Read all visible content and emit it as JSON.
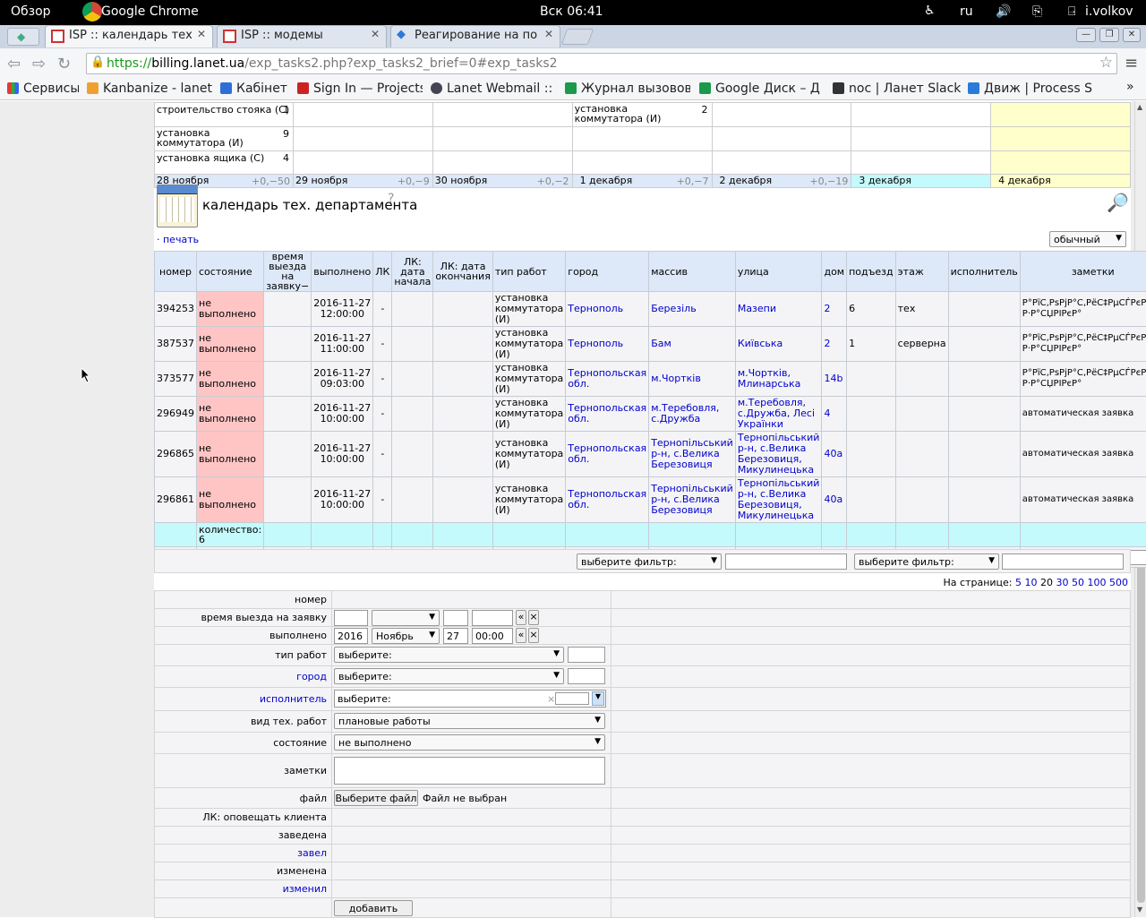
{
  "system": {
    "overview": "Обзор",
    "app": "Google Chrome",
    "clock": "Вск 06:41",
    "lang": "ru",
    "user": "i.volkov"
  },
  "tabs": [
    {
      "label": "ISP :: календарь тех"
    },
    {
      "label": "ISP :: модемы"
    },
    {
      "label": "Реагирование на по"
    }
  ],
  "url": {
    "scheme": "https://",
    "host": "billing.lanet.ua",
    "path": "/exp_tasks2.php?exp_tasks2_brief=0#exp_tasks2"
  },
  "bookmarks": [
    "Сервисы",
    "Kanbanize - lanet",
    "Кабінет",
    "Sign In — Projects",
    "Lanet Webmail :: ,",
    "Журнал вызовов",
    "Google Диск – Д",
    "noc | Ланет Slack",
    "Движ | Process S"
  ],
  "calendar": {
    "rows": [
      {
        "a": "строительство стояка (С)",
        "an": "1",
        "d": "установка коммутатора (И)",
        "dn": "2"
      },
      {
        "a": "установка коммутатора (И)",
        "an": "9",
        "d": "",
        "dn": ""
      },
      {
        "a": "установка ящика (С)",
        "an": "4",
        "d": "",
        "dn": ""
      }
    ],
    "days": [
      {
        "label": "28 ноября",
        "delta": "+0,−50"
      },
      {
        "label": "29 ноября",
        "delta": "+0,−9"
      },
      {
        "label": "30 ноября",
        "delta": "+0,−2"
      },
      {
        "label": "1 декабря",
        "delta": "+0,−7"
      },
      {
        "label": "2 декабря",
        "delta": "+0,−19"
      },
      {
        "label": "3 декабря",
        "delta": ""
      },
      {
        "label": "4 декабря",
        "delta": ""
      }
    ]
  },
  "section": {
    "title": "календарь тех. департамента",
    "help": "?",
    "print": "· печать",
    "view": "обычный"
  },
  "table": {
    "headers": [
      "номер",
      "состояние",
      "время выезда на заявку−",
      "выполнено",
      "ЛК",
      "ЛК: дата начала",
      "ЛК: дата окончания",
      "тип работ",
      "город",
      "массив",
      "улица",
      "дом",
      "подъезд",
      "этаж",
      "исполнитель",
      "заметки"
    ],
    "rows": [
      {
        "num": "394253",
        "state": "не выполнено",
        "done": "2016-11-27 12:00:00",
        "lk": "-",
        "type": "установка коммутатора (И)",
        "city": "Тернополь",
        "mass": "Березіль",
        "street": "Мазепи",
        "house": "2",
        "entr": "6",
        "floor": "тех",
        "note": "Р°РїС‚РѕРјР°С‚РёС‡РµСЃРєР°СЏ Р·Р°СЏРІРєР°"
      },
      {
        "num": "387537",
        "state": "не выполнено",
        "done": "2016-11-27 11:00:00",
        "lk": "-",
        "type": "установка коммутатора (И)",
        "city": "Тернополь",
        "mass": "Бам",
        "street": "Київська",
        "house": "2",
        "entr": "1",
        "floor": "серверна",
        "note": "Р°РїС‚РѕРјР°С‚РёС‡РµСЃРєР°СЏ Р·Р°СЏРІРєР°"
      },
      {
        "num": "373577",
        "state": "не выполнено",
        "done": "2016-11-27 09:03:00",
        "lk": "-",
        "type": "установка коммутатора (И)",
        "city": "Тернопольская обл.",
        "mass": "м.Чортків",
        "street": "м.Чортків, Млинарська",
        "house": "14b",
        "entr": "",
        "floor": "",
        "note": "Р°РїС‚РѕРјР°С‚РёС‡РµСЃРєР°СЏ Р·Р°СЏРІРєР°"
      },
      {
        "num": "296949",
        "state": "не выполнено",
        "done": "2016-11-27 10:00:00",
        "lk": "-",
        "type": "установка коммутатора (И)",
        "city": "Тернопольская обл.",
        "mass": "м.Теребовля, с.Дружба",
        "street": "м.Теребовля, с.Дружба, Лесі Українки",
        "house": "4",
        "entr": "",
        "floor": "",
        "note": "автоматическая заявка"
      },
      {
        "num": "296865",
        "state": "не выполнено",
        "done": "2016-11-27 10:00:00",
        "lk": "-",
        "type": "установка коммутатора (И)",
        "city": "Тернопольская обл.",
        "mass": "Тернопільський р-н, с.Велика Березовиця",
        "street": "Тернопільський р-н, с.Велика Березовиця, Микулинецька",
        "house": "40а",
        "entr": "",
        "floor": "",
        "note": "автоматическая заявка"
      },
      {
        "num": "296861",
        "state": "не выполнено",
        "done": "2016-11-27 10:00:00",
        "lk": "-",
        "type": "установка коммутатора (И)",
        "city": "Тернопольская обл.",
        "mass": "Тернопільський р-н, с.Велика Березовиця",
        "street": "Тернопільський р-н, с.Велика Березовиця, Микулинецька",
        "house": "40а",
        "entr": "",
        "floor": "",
        "note": "автоматическая заявка"
      }
    ],
    "count": "количество: 6",
    "filter": "выберите фильтр:",
    "perpage_label": "На странице:",
    "perpage": [
      "5",
      "10",
      "20",
      "30",
      "50",
      "100",
      "500"
    ]
  },
  "form": {
    "labels": {
      "num": "номер",
      "time": "время выезда на заявку",
      "done": "выполнено",
      "type": "тип работ",
      "city": "город",
      "exec": "исполнитель",
      "kind": "вид тех. работ",
      "state": "состояние",
      "notes": "заметки",
      "file": "файл",
      "lk": "ЛК: оповещать клиента",
      "created": "заведена",
      "creator": "завел",
      "changed": "изменена",
      "changer": "изменил"
    },
    "done_year": "2016",
    "done_month": "Ноябрь",
    "done_day": "27",
    "done_time": "00:00",
    "prev": "«",
    "clear": "×",
    "choose": "выберите:",
    "kind_value": "плановые работы",
    "state_value": "не выполнено",
    "file_button": "Выберите файл",
    "file_none": "Файл не выбран",
    "submit": "добавить"
  }
}
